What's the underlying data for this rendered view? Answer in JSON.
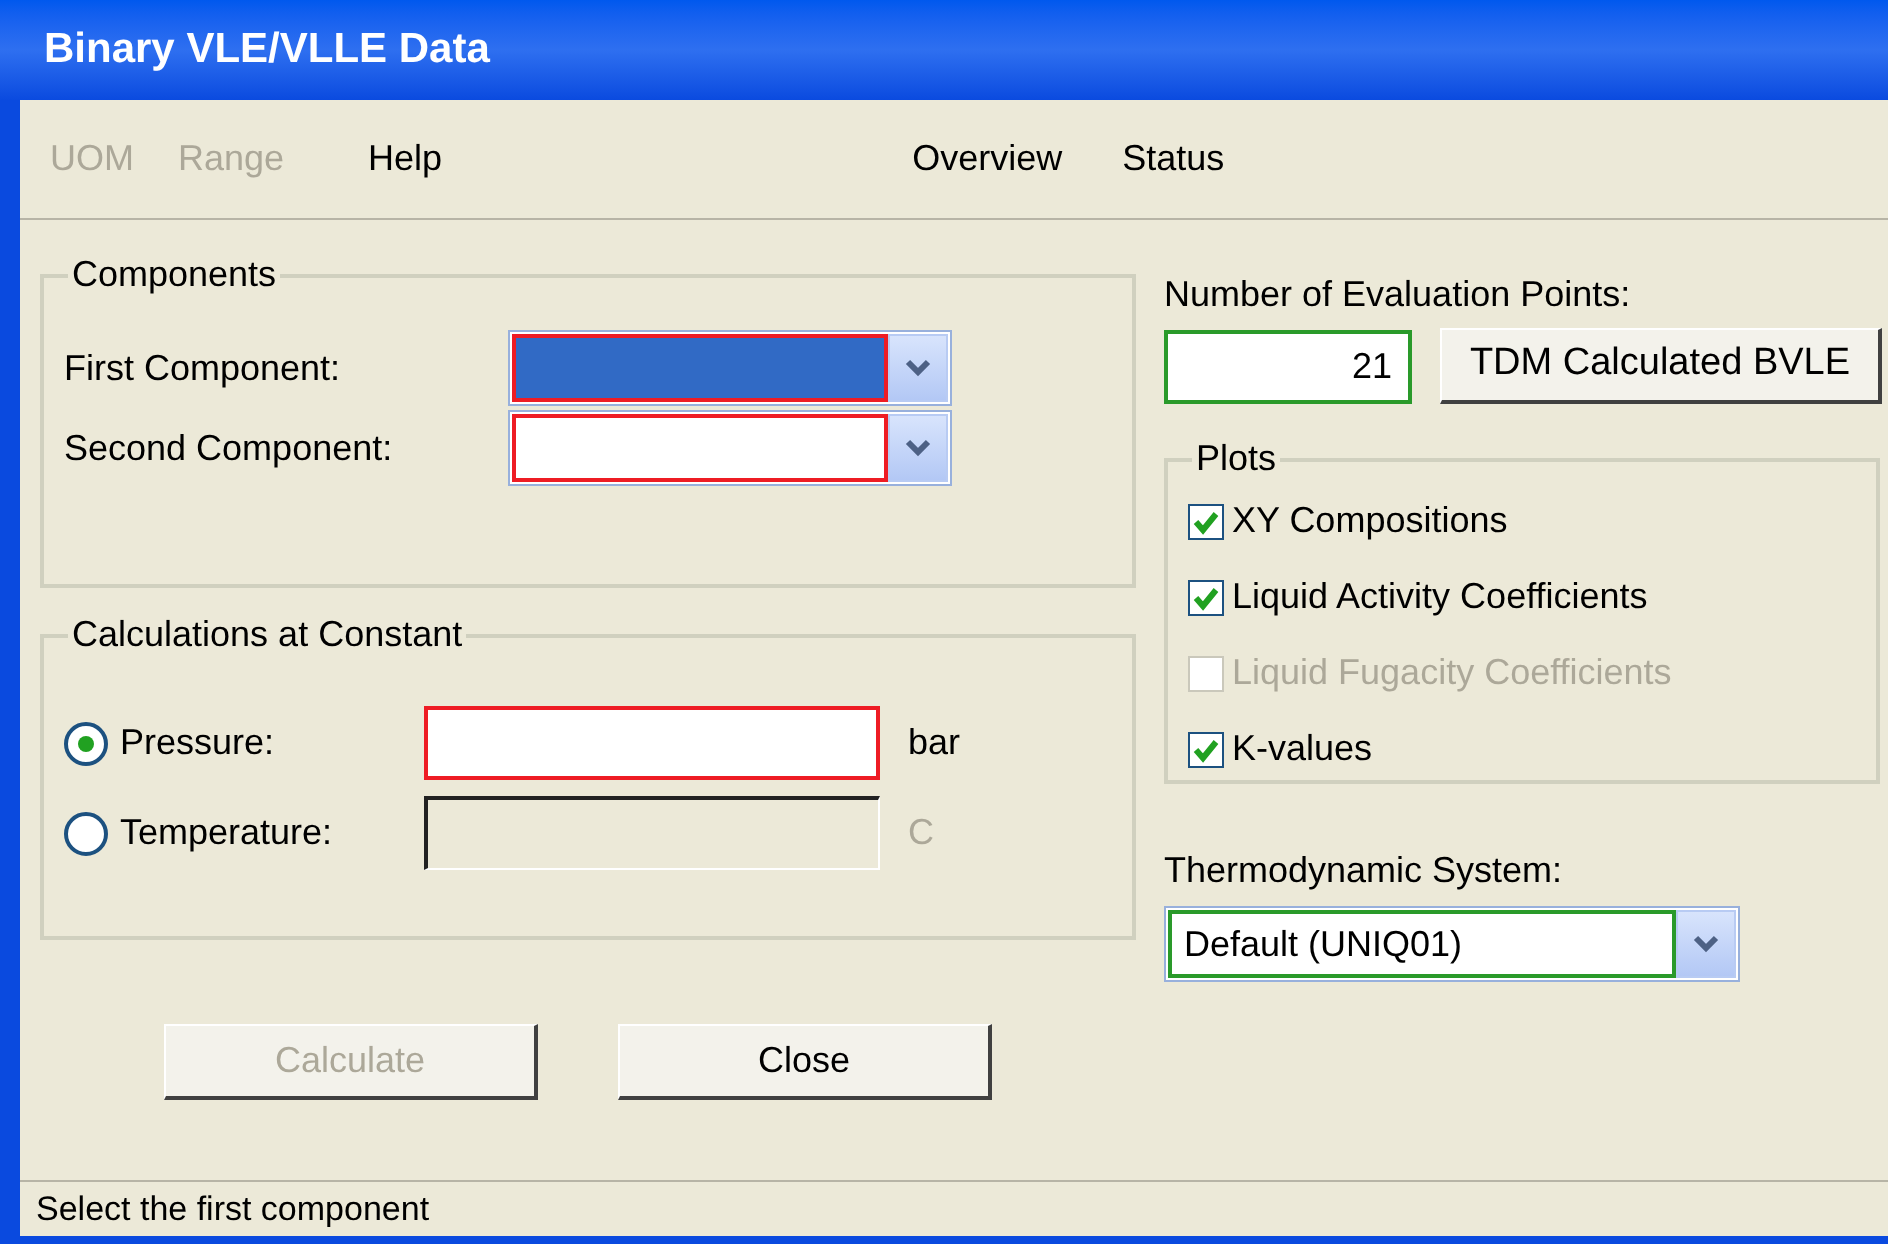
{
  "window": {
    "title": "Binary VLE/VLLE Data"
  },
  "menu": [
    {
      "label": "UOM",
      "disabled": true
    },
    {
      "label": "Range",
      "disabled": true
    },
    {
      "label": "Help",
      "disabled": false
    }
  ],
  "nav": [
    {
      "label": "Overview"
    },
    {
      "label": "Status"
    }
  ],
  "components": {
    "title": "Components",
    "fields": [
      {
        "label": "First Component:",
        "focused": true,
        "required": true
      },
      {
        "label": "Second Component:",
        "focused": false,
        "required": true
      }
    ]
  },
  "calculations": {
    "title": "Calculations at Constant",
    "options": [
      {
        "label": "Pressure:",
        "selected": true,
        "unit": "bar"
      },
      {
        "label": "Temperature:",
        "selected": false,
        "unit": "C"
      }
    ]
  },
  "evaluation": {
    "label": "Number of Evaluation Points:",
    "value": "21",
    "button": "TDM Calculated BVLE"
  },
  "plots": {
    "title": "Plots",
    "items": [
      {
        "label": "XY Compositions",
        "checked": true,
        "disabled": false
      },
      {
        "label": "Liquid Activity Coefficients",
        "checked": true,
        "disabled": false
      },
      {
        "label": "Liquid Fugacity Coefficients",
        "checked": false,
        "disabled": true
      },
      {
        "label": "K-values",
        "checked": true,
        "disabled": false
      }
    ]
  },
  "thermo": {
    "label": "Thermodynamic System:",
    "value": "Default (UNIQ01)"
  },
  "buttons": [
    {
      "label": "Calculate",
      "disabled": true
    },
    {
      "label": "Close",
      "disabled": false
    }
  ],
  "status_bar": "Select the first component"
}
